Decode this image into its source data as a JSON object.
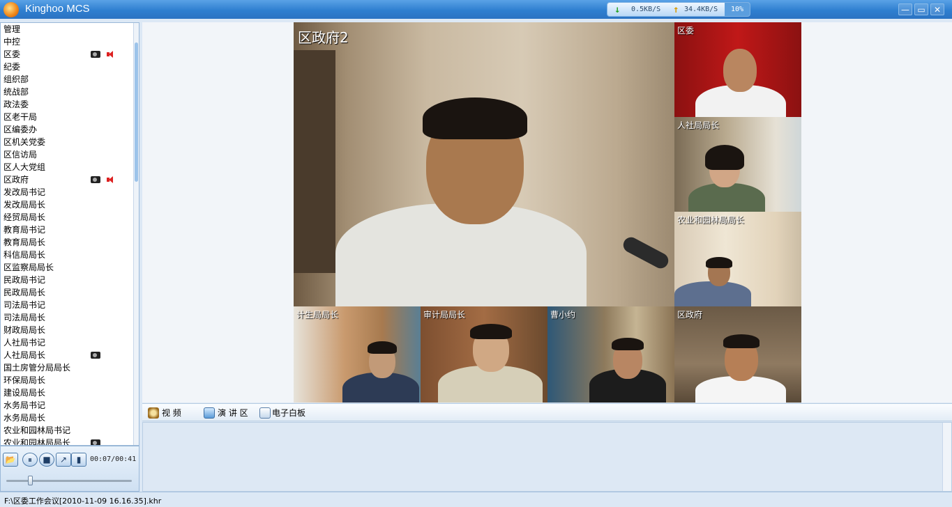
{
  "app": {
    "title": "Kinghoo MCS"
  },
  "netstat": {
    "down": "0.5KB/S",
    "up": "34.4KB/S",
    "percent": "10%"
  },
  "sidebar": {
    "items": [
      {
        "label": "管理",
        "cam": false,
        "spk": false
      },
      {
        "label": "中控",
        "cam": false,
        "spk": false
      },
      {
        "label": "区委",
        "cam": true,
        "spk": true
      },
      {
        "label": "纪委",
        "cam": false,
        "spk": false
      },
      {
        "label": "组织部",
        "cam": false,
        "spk": false
      },
      {
        "label": "统战部",
        "cam": false,
        "spk": false
      },
      {
        "label": "政法委",
        "cam": false,
        "spk": false
      },
      {
        "label": "区老干局",
        "cam": false,
        "spk": false
      },
      {
        "label": "区编委办",
        "cam": false,
        "spk": false
      },
      {
        "label": "区机关党委",
        "cam": false,
        "spk": false
      },
      {
        "label": "区信访局",
        "cam": false,
        "spk": false
      },
      {
        "label": "区人大党组",
        "cam": false,
        "spk": false
      },
      {
        "label": "区政府",
        "cam": true,
        "spk": true
      },
      {
        "label": "发改局书记",
        "cam": false,
        "spk": false
      },
      {
        "label": "发改局局长",
        "cam": false,
        "spk": false
      },
      {
        "label": "经贸局局长",
        "cam": false,
        "spk": false
      },
      {
        "label": "教育局书记",
        "cam": false,
        "spk": false
      },
      {
        "label": "教育局局长",
        "cam": false,
        "spk": false
      },
      {
        "label": "科信局局长",
        "cam": false,
        "spk": false
      },
      {
        "label": "区监察局局长",
        "cam": false,
        "spk": false
      },
      {
        "label": "民政局书记",
        "cam": false,
        "spk": false
      },
      {
        "label": "民政局局长",
        "cam": false,
        "spk": false
      },
      {
        "label": "司法局书记",
        "cam": false,
        "spk": false
      },
      {
        "label": "司法局局长",
        "cam": false,
        "spk": false
      },
      {
        "label": "财政局局长",
        "cam": false,
        "spk": false
      },
      {
        "label": "人社局书记",
        "cam": false,
        "spk": false
      },
      {
        "label": "人社局局长",
        "cam": true,
        "spk": false
      },
      {
        "label": "国土房管分局局长",
        "cam": false,
        "spk": false
      },
      {
        "label": "环保局局长",
        "cam": false,
        "spk": false
      },
      {
        "label": "建设局局长",
        "cam": false,
        "spk": false
      },
      {
        "label": "水务局书记",
        "cam": false,
        "spk": false
      },
      {
        "label": "水务局局长",
        "cam": false,
        "spk": false
      },
      {
        "label": "农业和园林局书记",
        "cam": false,
        "spk": false
      },
      {
        "label": "农业和园林局局长",
        "cam": true,
        "spk": false
      }
    ]
  },
  "player": {
    "time": "00:07/00:41",
    "progress": 0.17
  },
  "video": {
    "main": "区政府2",
    "tiles": [
      "区委",
      "人社局局长",
      "农业和园林局局长",
      "计生局局长",
      "审计局局长",
      "曹小约",
      "区政府"
    ]
  },
  "tabs": {
    "video": "视 频",
    "speech": "演 讲 区",
    "whiteboard": "电子白板"
  },
  "status": {
    "path": "F:\\区委工作会议[2010-11-09 16.16.35].khr"
  }
}
